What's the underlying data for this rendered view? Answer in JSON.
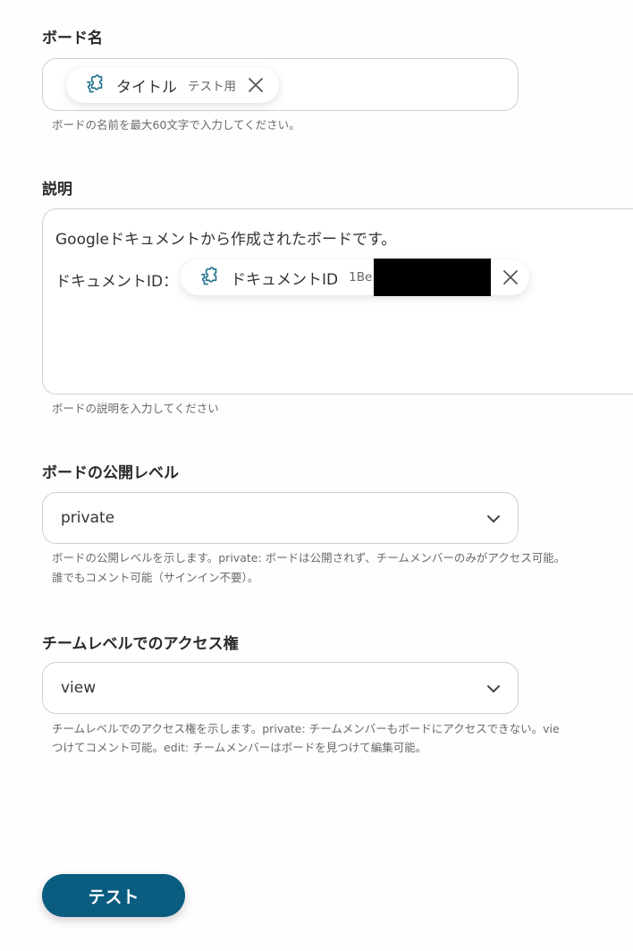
{
  "board_name": {
    "label": "ボード名",
    "chip": {
      "title": "タイトル",
      "subtitle": "テスト用"
    },
    "help": "ボードの名前を最大60文字で入力してください。"
  },
  "description": {
    "label": "説明",
    "line1": "Googleドキュメントから作成されたボードです。",
    "line2_prefix": "ドキュメントID：",
    "chip": {
      "title": "ドキュメントID",
      "subtitle": "1Be"
    },
    "help": "ボードの説明を入力してください"
  },
  "visibility": {
    "label": "ボードの公開レベル",
    "value": "private",
    "help_line1": "ボードの公開レベルを示します。private: ボードは公開されず、チームメンバーのみがアクセス可能。",
    "help_line2": "誰でもコメント可能（サインイン不要）。"
  },
  "team_access": {
    "label": "チームレベルでのアクセス権",
    "value": "view",
    "help_line1": "チームレベルでのアクセス権を示します。private: チームメンバーもボードにアクセスできない。vie",
    "help_line2": "つけてコメント可能。edit: チームメンバーはボードを見つけて編集可能。"
  },
  "test_button": {
    "label": "テスト"
  },
  "colors": {
    "accent": "#0a5d80",
    "icon": "#1f6f8b"
  },
  "icons": {
    "chip_icon": "puzzle-icon",
    "remove_icon": "close-icon",
    "dropdown_icon": "chevron-down-icon"
  }
}
